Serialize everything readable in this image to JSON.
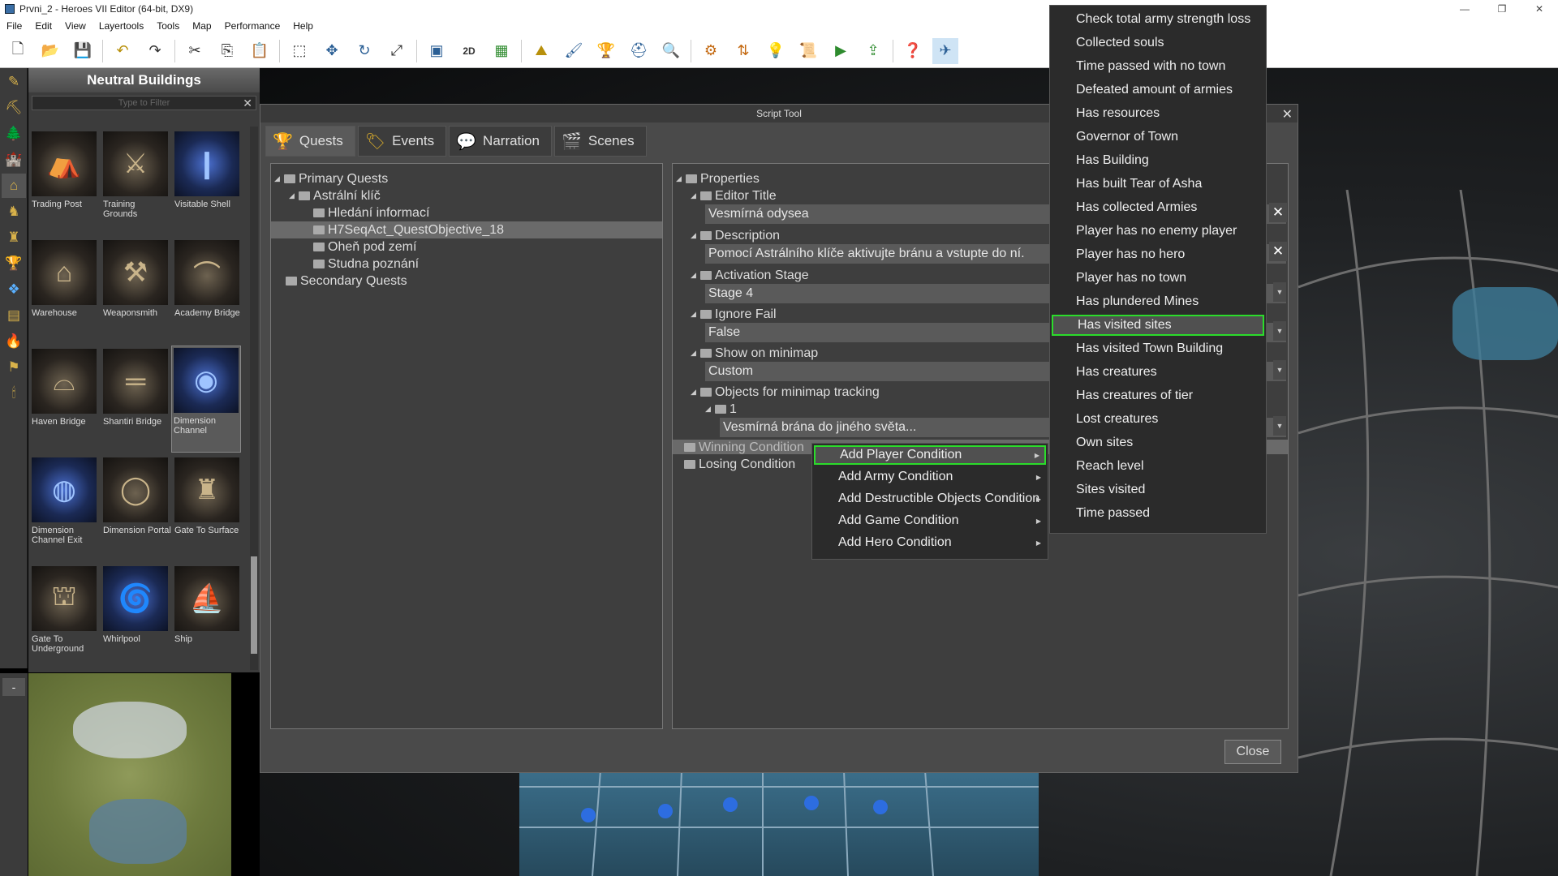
{
  "window": {
    "title": "Prvni_2 - Heroes VII Editor (64-bit, DX9)",
    "controls": [
      "—",
      "❐",
      "✕"
    ]
  },
  "menubar": [
    "File",
    "Edit",
    "View",
    "Layertools",
    "Tools",
    "Map",
    "Performance",
    "Help"
  ],
  "toolbar": {
    "icons": [
      "new-file-icon",
      "open-folder-icon",
      "save-icon",
      "undo-icon",
      "redo-icon",
      "cut-icon",
      "copy-icon",
      "paste-icon",
      "select-icon",
      "move-icon",
      "rotate-icon",
      "scale-icon",
      "screenshot-icon",
      "2d-icon",
      "grid-icon",
      "terrain-icon",
      "brush-icon",
      "trophy-icon",
      "helmet-icon",
      "magnifier-icon",
      "gear-icon",
      "transfer-icon",
      "lightbulb-icon",
      "script-icon",
      "play-icon",
      "export-icon",
      "help-icon",
      "map-tool-icon"
    ],
    "labels": {
      "2d": "2D"
    }
  },
  "neutral_buildings": {
    "title": "Neutral Buildings",
    "filter_placeholder": "Type to Filter",
    "items": [
      {
        "label": "Trading Post",
        "icon": "trading-post-icon"
      },
      {
        "label": "Training Grounds",
        "icon": "training-grounds-icon"
      },
      {
        "label": "Visitable Shell",
        "icon": "visitable-shell-icon"
      },
      {
        "label": "Warehouse",
        "icon": "warehouse-icon"
      },
      {
        "label": "Weaponsmith",
        "icon": "weaponsmith-icon"
      },
      {
        "label": "Academy Bridge",
        "icon": "academy-bridge-icon"
      },
      {
        "label": "Haven Bridge",
        "icon": "haven-bridge-icon"
      },
      {
        "label": "Shantiri Bridge",
        "icon": "shantiri-bridge-icon"
      },
      {
        "label": "Dimension Channel",
        "icon": "dimension-channel-icon",
        "selected": true
      },
      {
        "label": "Dimension Channel Exit",
        "icon": "dimension-channel-exit-icon"
      },
      {
        "label": "Dimension Portal",
        "icon": "dimension-portal-icon"
      },
      {
        "label": "Gate To Surface",
        "icon": "gate-to-surface-icon"
      },
      {
        "label": "Gate To Underground",
        "icon": "gate-to-underground-icon"
      },
      {
        "label": "Whirlpool",
        "icon": "whirlpool-icon"
      },
      {
        "label": "Ship",
        "icon": "ship-icon"
      }
    ]
  },
  "minimap": {
    "button_label": "-"
  },
  "script_tool": {
    "title": "Script Tool",
    "tabs": [
      {
        "label": "Quests",
        "icon": "trophy-icon",
        "active": true
      },
      {
        "label": "Events",
        "icon": "events-icon"
      },
      {
        "label": "Narration",
        "icon": "narration-icon"
      },
      {
        "label": "Scenes",
        "icon": "scenes-icon"
      }
    ],
    "quest_tree": [
      {
        "label": "Primary Quests",
        "level": 0,
        "expanded": true
      },
      {
        "label": "Astrální klíč",
        "level": 1,
        "expanded": true
      },
      {
        "label": "Hledání informací",
        "level": 2
      },
      {
        "label": "H7SeqAct_QuestObjective_18",
        "level": 2,
        "selected": true
      },
      {
        "label": "Oheň pod zemí",
        "level": 2
      },
      {
        "label": "Studna poznání",
        "level": 2
      },
      {
        "label": "Secondary Quests",
        "level": 0
      }
    ],
    "properties": {
      "root": "Properties",
      "editor_title_label": "Editor Title",
      "editor_title_value": "Vesmírná odysea",
      "description_label": "Description",
      "description_value": "Pomocí Astrálního klíče aktivujte bránu a vstupte do ní.",
      "activation_stage_label": "Activation Stage",
      "activation_stage_value": "Stage 4",
      "ignore_fail_label": "Ignore Fail",
      "ignore_fail_value": "False",
      "show_on_minimap_label": "Show on minimap",
      "show_on_minimap_value": "Custom",
      "objects_tracking_label": "Objects for minimap tracking",
      "objects_tracking_index": "1",
      "objects_tracking_value": "Vesmírná brána do jiného světa...",
      "winning_condition_label": "Winning Condition",
      "losing_condition_label": "Losing Condition"
    },
    "close_label": "Close"
  },
  "context_menu": [
    {
      "label": "Add Player Condition",
      "highlighted": true
    },
    {
      "label": "Add Army Condition"
    },
    {
      "label": "Add Destructible Objects Condition"
    },
    {
      "label": "Add Game Condition"
    },
    {
      "label": "Add Hero Condition"
    }
  ],
  "submenu": [
    {
      "label": "Check total army strength loss"
    },
    {
      "label": "Collected souls"
    },
    {
      "label": "Time passed with no town"
    },
    {
      "label": "Defeated amount of armies"
    },
    {
      "label": "Has resources"
    },
    {
      "label": "Governor of Town"
    },
    {
      "label": "Has Building"
    },
    {
      "label": "Has built Tear of Asha"
    },
    {
      "label": "Has collected Armies"
    },
    {
      "label": "Player has no enemy player"
    },
    {
      "label": "Player has no hero"
    },
    {
      "label": "Player has no town"
    },
    {
      "label": "Has plundered Mines"
    },
    {
      "label": "Has visited sites",
      "highlighted": true
    },
    {
      "label": "Has visited Town Building"
    },
    {
      "label": "Has creatures"
    },
    {
      "label": "Has creatures of tier"
    },
    {
      "label": "Lost creatures"
    },
    {
      "label": "Own sites"
    },
    {
      "label": "Reach level"
    },
    {
      "label": "Sites visited"
    },
    {
      "label": "Time passed"
    }
  ],
  "colors": {
    "highlight_border": "#2bdc2b",
    "panel_bg": "#3c3c3c",
    "dialog_bg": "#4a4a4a"
  }
}
